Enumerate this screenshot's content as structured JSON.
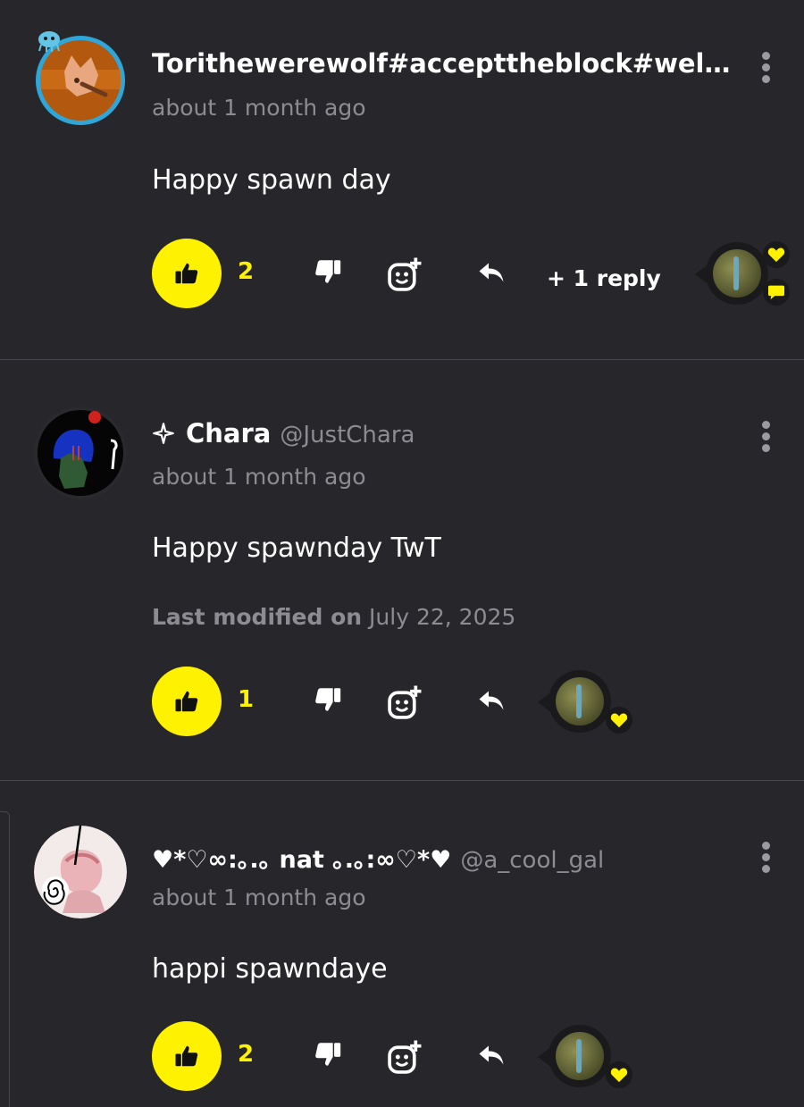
{
  "comments": [
    {
      "username": "Torithewerewolf#accepttheblock#welov…",
      "handle": "",
      "time": "about 1 month ago",
      "text": "Happy spawn day",
      "modified_label": "",
      "modified_date": "",
      "likes": "2",
      "replies": "+ 1 reply"
    },
    {
      "prefix_icon": "sparkle-icon",
      "username": "Chara",
      "handle": "@JustChara",
      "time": "about 1 month ago",
      "text": "Happy spawnday TwT",
      "modified_label": "Last modified on",
      "modified_date": "July 22, 2025",
      "likes": "1",
      "replies": ""
    },
    {
      "username": "♥*♡∞:｡.｡ nat ｡.｡:∞♡*♥",
      "handle": "@a_cool_gal",
      "time": "about 1 month ago",
      "text": "happi spawndaye",
      "modified_label": "",
      "modified_date": "",
      "likes": "2",
      "replies": ""
    }
  ],
  "colors": {
    "background": "#27272b",
    "accent": "#fff200",
    "muted_text": "#8c8c92",
    "divider": "#46464c"
  },
  "icons": {
    "like": "thumbs-up-icon",
    "dislike": "thumbs-down-icon",
    "react": "add-emoji-icon",
    "reply": "reply-arrow-icon",
    "more": "kebab-menu-icon"
  }
}
